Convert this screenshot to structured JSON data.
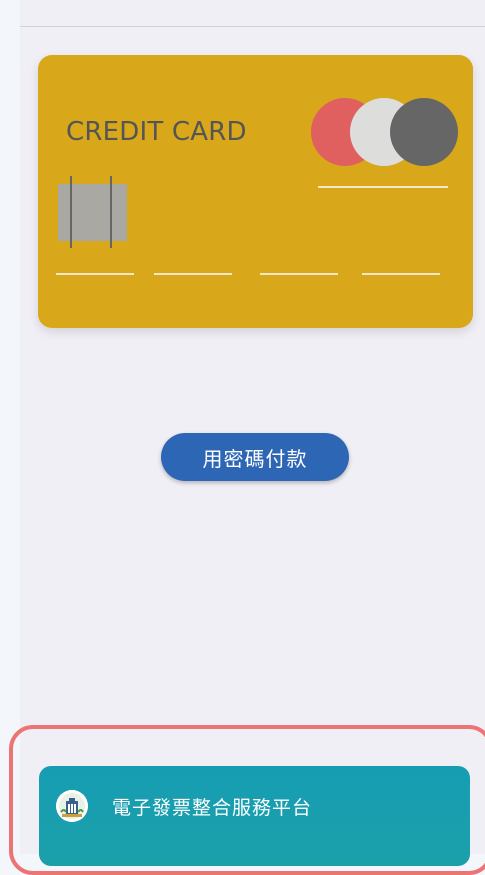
{
  "card": {
    "title": "CREDIT CARD",
    "colors": {
      "card": "#d8a71a",
      "circle_left": "#e06060",
      "circle_mid": "#dddddb",
      "circle_right": "#666666"
    }
  },
  "payment": {
    "button_label": "用密碼付款",
    "button_color": "#2e66b6"
  },
  "einvoice": {
    "title": "電子發票整合服務平台",
    "icon": "einvoice-platform-logo-icon",
    "highlight_color": "#ec7474"
  }
}
